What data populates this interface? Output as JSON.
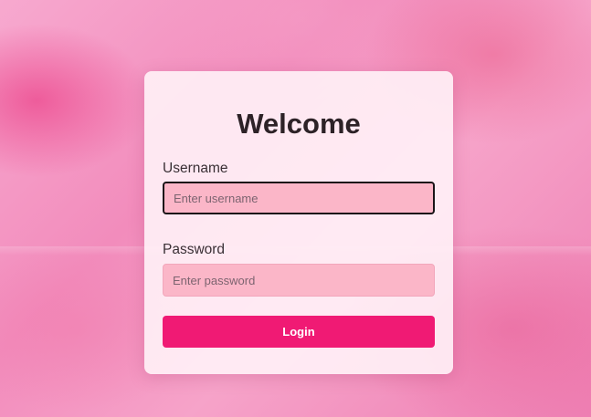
{
  "login": {
    "title": "Welcome",
    "username_label": "Username",
    "username_placeholder": "Enter username",
    "password_label": "Password",
    "password_placeholder": "Enter password",
    "button_label": "Login"
  },
  "colors": {
    "accent": "#f01a74",
    "input_background": "#fbb6c8",
    "card_background": "#fff0f6",
    "background": "#f28cbc"
  }
}
